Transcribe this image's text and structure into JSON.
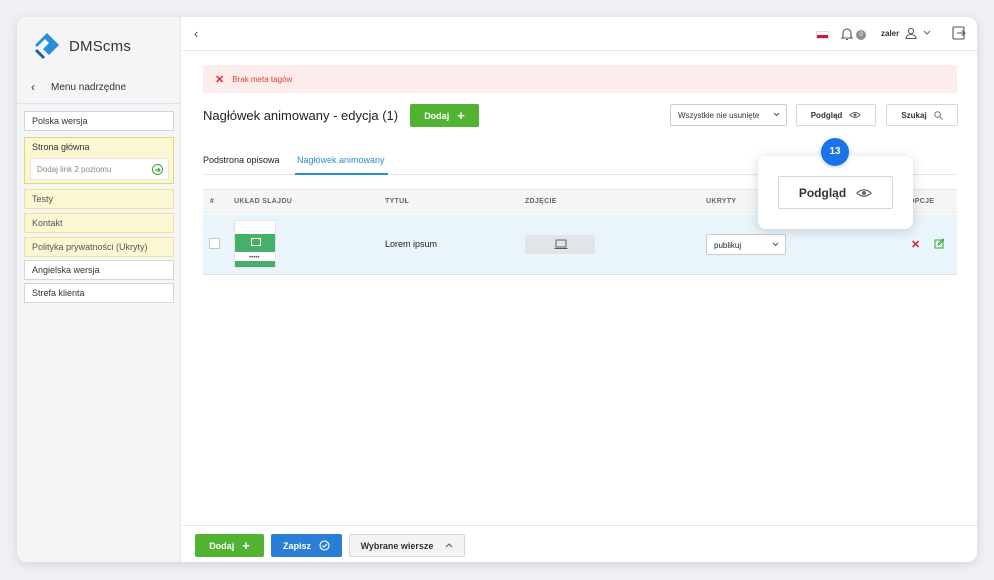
{
  "app": {
    "name": "DMScms"
  },
  "sidebar": {
    "back_label": "Menu nadrzędne",
    "items": [
      {
        "label": "Polska wersja"
      },
      {
        "label": "Strona główna",
        "sub_placeholder": "Dodaj link 2 poziomu"
      },
      {
        "label": "Testy"
      },
      {
        "label": "Kontakt"
      },
      {
        "label": "Polityka prywatności (Ukryty)"
      },
      {
        "label": "Angielska wersja"
      },
      {
        "label": "Strefa klienta"
      }
    ]
  },
  "topbar": {
    "notifications_count": "0",
    "username": "zaler",
    "flag_colors": [
      "#ffffff",
      "#dc143c"
    ]
  },
  "alert": {
    "message": "Brak meta tagów"
  },
  "header": {
    "title": "Nagłówek animowany - edycja (1)",
    "add_label": "Dodaj",
    "filter_value": "Wszystkie nie usunięte",
    "preview_label": "Podgląd",
    "search_label": "Szukaj"
  },
  "tabs": [
    {
      "label": "Podstrona opisowa",
      "active": false
    },
    {
      "label": "Nagłówek animowany",
      "active": true
    }
  ],
  "table": {
    "columns": [
      "#",
      "UKŁAD SLAJDU",
      "TYTUŁ",
      "ZDJĘCIE",
      "UKRYTY",
      "OPCJE"
    ],
    "rows": [
      {
        "title": "Lorem ipsum",
        "hidden": "publikuj"
      }
    ]
  },
  "popover": {
    "step": "13",
    "preview_label": "Podgląd"
  },
  "bottom": {
    "add_label": "Dodaj",
    "save_label": "Zapisz",
    "selected_label": "Wybrane wiersze"
  },
  "colors": {
    "accent_green": "#52b232",
    "accent_blue": "#2a7fd4",
    "step_blue": "#1a73e8",
    "alert_red": "#e02020"
  }
}
